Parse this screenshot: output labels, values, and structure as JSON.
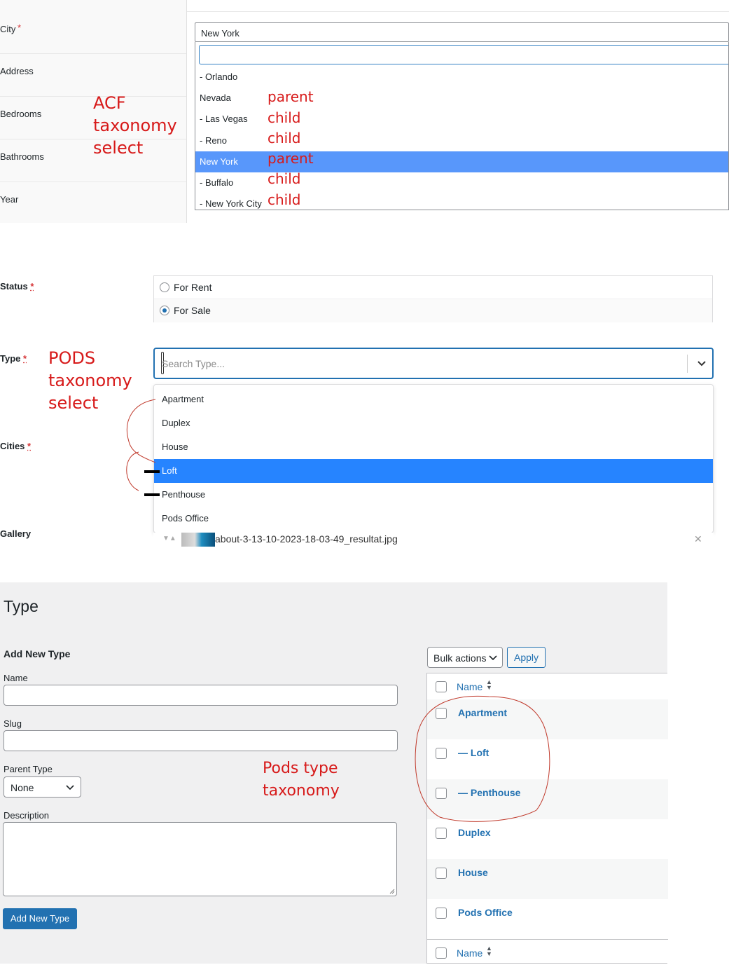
{
  "acf": {
    "fields": [
      {
        "label": "City",
        "required": "*"
      },
      {
        "label": "Address"
      },
      {
        "label": "Bedrooms"
      },
      {
        "label": "Bathrooms"
      },
      {
        "label": "Year"
      }
    ],
    "selected_value": "New York",
    "options": [
      {
        "label": "- Orlando",
        "note": ""
      },
      {
        "label": "Nevada",
        "note": "parent"
      },
      {
        "label": "- Las Vegas",
        "note": "child"
      },
      {
        "label": "- Reno",
        "note": "child"
      },
      {
        "label": "New York",
        "note": "parent",
        "selected": true
      },
      {
        "label": "- Buffalo",
        "note": "child"
      },
      {
        "label": "- New York City",
        "note": "child"
      }
    ],
    "annotation": [
      "ACF",
      "taxonomy",
      "select"
    ]
  },
  "pods": {
    "status": {
      "label": "Status",
      "required": "*",
      "options": [
        "For Rent",
        "For Sale"
      ],
      "selected": "For Sale"
    },
    "type": {
      "label": "Type",
      "required": "*",
      "placeholder": "Search Type..."
    },
    "cities": {
      "label": "Cities",
      "required": "*"
    },
    "gallery": {
      "label": "Gallery",
      "file_name": "about-3-13-10-2023-18-03-49_resultat.jpg",
      "remove_glyph": "✕"
    },
    "options": [
      "Apartment",
      "Duplex",
      "House",
      "Loft",
      "Penthouse",
      "Pods Office"
    ],
    "selected_option": "Loft",
    "annotation": [
      "PODS",
      "taxonomy",
      "select"
    ]
  },
  "taxonomy_page": {
    "title": "Type",
    "add_heading": "Add New Type",
    "name_label": "Name",
    "slug_label": "Slug",
    "parent_label": "Parent Type",
    "parent_value": "None",
    "description_label": "Description",
    "submit_label": "Add New Type",
    "bulk_actions": "Bulk actions",
    "apply_label": "Apply",
    "column_name": "Name",
    "rows": [
      "Apartment",
      "— Loft",
      "— Penthouse",
      "Duplex",
      "House",
      "Pods Office"
    ],
    "annotation": [
      "Pods type",
      "taxonomy"
    ]
  },
  "colors": {
    "accent": "#2271b1",
    "select_highlight": "#5897fb",
    "pods_highlight": "#2684ff",
    "annotation": "#d71a1a"
  }
}
